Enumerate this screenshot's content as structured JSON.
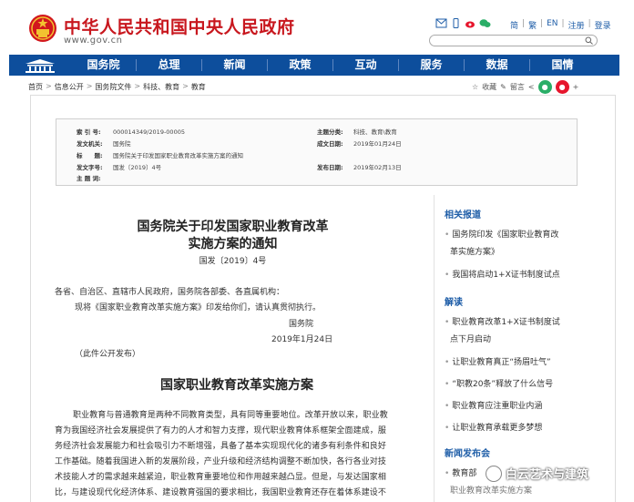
{
  "header": {
    "title": "中华人民共和国中央人民政府",
    "url": "www.gov.cn",
    "links": [
      "简",
      "繁",
      "EN",
      "注册",
      "登录"
    ]
  },
  "nav": {
    "items": [
      "国务院",
      "总理",
      "新闻",
      "政策",
      "互动",
      "服务",
      "数据",
      "国情"
    ]
  },
  "breadcrumb": [
    "首页",
    "信息公开",
    "国务院文件",
    "科技、教育",
    "教育"
  ],
  "tools": {
    "favorite": "收藏",
    "print": "留言"
  },
  "meta": {
    "index_label": "索 引 号:",
    "index_value": "000014349/2019-00005",
    "issuer_label": "发文机关:",
    "issuer_value": "国务院",
    "subject_label": "标　　题:",
    "subject_value": "国务院关于印发国家职业教育改革实施方案的通知",
    "docno_label": "发文字号:",
    "docno_value": "国发〔2019〕4号",
    "keywords_label": "主 题 词:",
    "keywords_value": "",
    "category_label": "主题分类:",
    "category_value": "科技、教育\\教育",
    "date_label": "成文日期:",
    "date_value": "2019年01月24日",
    "pubdate_label": "发布日期:",
    "pubdate_value": "2019年02月13日"
  },
  "doc": {
    "title_line1": "国务院关于印发国家职业教育改革",
    "title_line2": "实施方案的通知",
    "number": "国发〔2019〕4号",
    "addressee": "各省、自治区、直辖市人民政府，国务院各部委、各直属机构：",
    "notice": "现将《国家职业教育改革实施方案》印发给你们，请认真贯彻执行。",
    "signer": "国务院",
    "sign_date": "2019年1月24日",
    "public_note": "（此件公开发布）",
    "section_title": "国家职业教育改革实施方案",
    "body": [
      "职业教育与普通教育是两种不同教育类型，具有同等重要地位。改革开放以来，职业教",
      "育为我国经济社会发展提供了有力的人才和智力支撑，现代职业教育体系框架全面建成，服",
      "务经济社会发展能力和社会吸引力不断增强，具备了基本实现现代化的诸多有利条件和良好",
      "工作基础。随着我国进入新的发展阶段，产业升级和经济结构调整不断加快，各行各业对技",
      "术技能人才的需求越来越紧迫，职业教育重要地位和作用越来越凸显。但是，与发达国家相",
      "比，与建设现代化经济体系、建设教育强国的要求相比，我国职业教育还存在着体系建设不"
    ]
  },
  "sidebar": {
    "related_heading": "相关报道",
    "related": [
      "国务院印发《国家职业教育改",
      "革实施方案》",
      "我国将启动1+X证书制度试点"
    ],
    "interp_heading": "解读",
    "interp": [
      "职业教育改革1+X证书制度试",
      "点下月启动",
      "让职业教育真正“扬眉吐气”",
      "“职教20条”释放了什么信号",
      "职业教育应注重职业内涵",
      "让职业教育承载更多梦想"
    ],
    "pub_heading": "新闻发布会",
    "pub": [
      "教育部",
      "职业教育改革实施方案"
    ]
  },
  "watermark": "白云艺术与建筑"
}
